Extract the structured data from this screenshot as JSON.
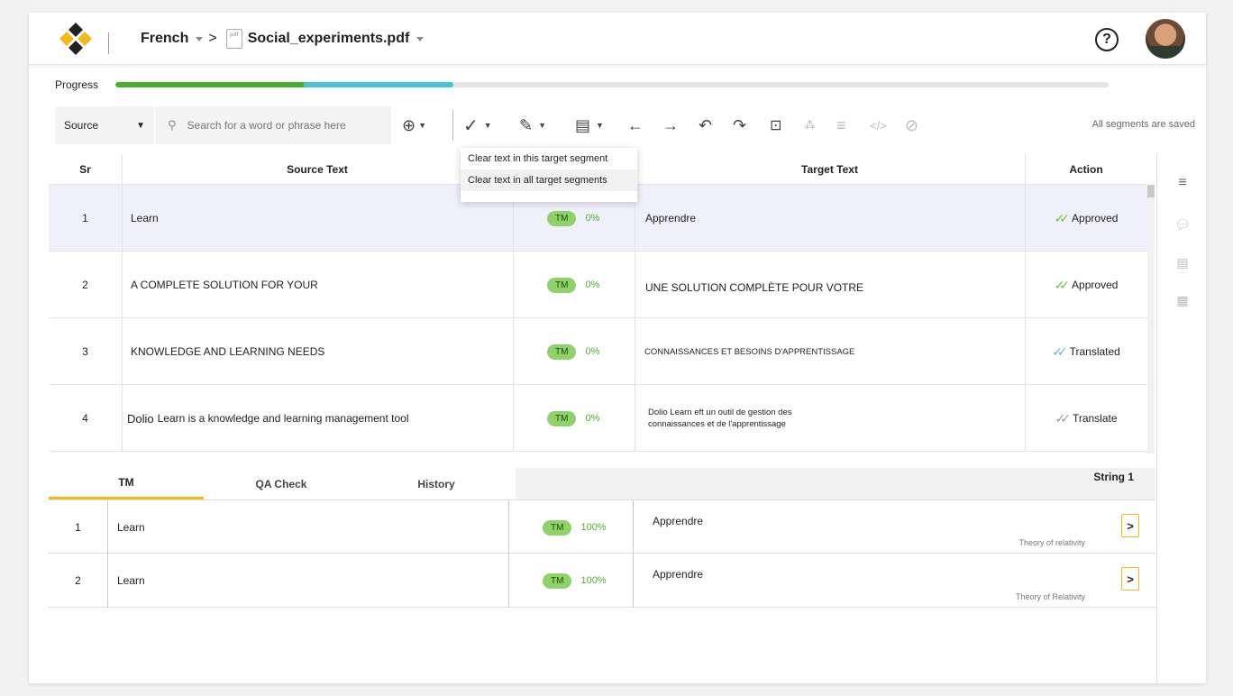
{
  "header": {
    "language": "French",
    "file_name": "Social_experiments.pdf",
    "help_icon": "question-circle-icon",
    "pdf_icon_text": "pdf"
  },
  "progress": {
    "label": "Progress",
    "approved_fraction": 0.19,
    "translated_fraction": 0.15
  },
  "toolbar": {
    "source_select": "Source",
    "search_placeholder": "Search for a word or phrase here",
    "status_text": "All segments are saved"
  },
  "clear_menu": {
    "items": [
      "Clear text in this target segment",
      "Clear text in all target segments"
    ]
  },
  "table": {
    "headers": {
      "sr": "Sr",
      "source": "Source Text",
      "target": "Target Text",
      "action": "Action"
    },
    "rows": [
      {
        "sr": "1",
        "source": "Learn",
        "badge": "TM",
        "match": "0%",
        "target": "Apprendre",
        "status": "Approved",
        "check_color": "#6cc04a"
      },
      {
        "sr": "2",
        "source": "A COMPLETE SOLUTION FOR YOUR",
        "badge": "TM",
        "match": "0%",
        "target": "UNE SOLUTION COMPLÈTE POUR VOTRE",
        "status": "Approved",
        "check_color": "#6cc04a"
      },
      {
        "sr": "3",
        "source": "KNOWLEDGE AND LEARNING NEEDS",
        "badge": "TM",
        "match": "0%",
        "target": "CONNAISSANCES ET BESOINS D'APPRENTISSAGE",
        "status": "Translated",
        "check_color": "#64b5d6"
      },
      {
        "sr": "4",
        "source_prefix": "Dolio",
        "source": "Learn is a knowledge and learning management tool",
        "badge": "TM",
        "match": "0%",
        "target_line1": "Dolio Learn eft un outil de gestion des",
        "target_line2": "connaissances et de l'apprentissage",
        "status": "Translate",
        "check_color": "#999999"
      }
    ]
  },
  "bottom": {
    "tabs": [
      "TM",
      "QA Check",
      "History"
    ],
    "string_label": "String 1",
    "rows": [
      {
        "n": "1",
        "source": "Learn",
        "badge": "TM",
        "match": "100%",
        "target": "Apprendre",
        "reference": "Theory of relativity"
      },
      {
        "n": "2",
        "source": "Learn",
        "badge": "TM",
        "match": "100%",
        "target": "Apprendre",
        "reference": "Theory of Relativity"
      }
    ]
  },
  "colors": {
    "accent": "#f4b81c",
    "progress_green": "#4caf32",
    "progress_blue": "#46c3d6",
    "tm_badge": "#8fd26a"
  }
}
